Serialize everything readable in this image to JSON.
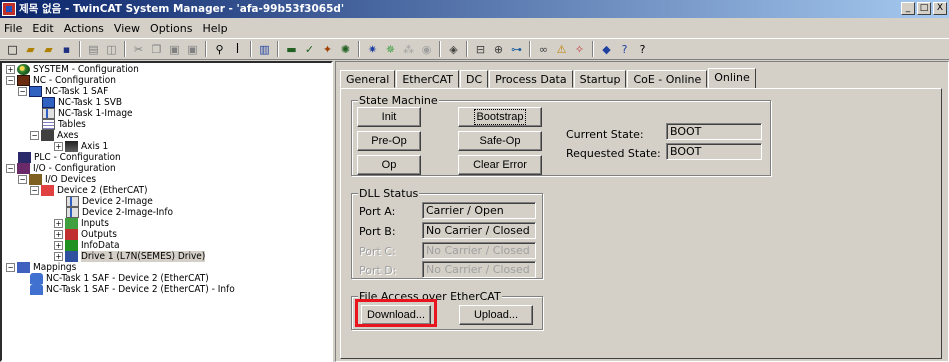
{
  "window": {
    "title": "제목 없음 - TwinCAT System Manager - 'afa-99b53f3065d'",
    "buttons": [
      "_",
      "□",
      "X"
    ]
  },
  "menu": {
    "items": [
      {
        "label": "File"
      },
      {
        "label": "Edit"
      },
      {
        "label": "Actions"
      },
      {
        "label": "View"
      },
      {
        "label": "Options"
      },
      {
        "label": "Help"
      }
    ]
  },
  "toolbar": {
    "icons": [
      "new-icon",
      "open-icon",
      "open-folder-icon",
      "save-icon",
      "print-icon",
      "print-preview-icon",
      "cut-icon",
      "copy-icon",
      "paste-icon",
      "paste-link-icon",
      "find-icon",
      "find-next-icon",
      "monitor-icon",
      "activate-icon",
      "check-icon",
      "set-run-icon",
      "restart-icon",
      "target-icon",
      "scan-icon",
      "toggle-icon",
      "free-run-icon",
      "show-online-icon",
      "zoom-icon",
      "link-icon",
      "var-icon",
      "var-new-icon",
      "help-icon",
      "about-icon"
    ]
  },
  "tree": {
    "nodes": [
      {
        "label": "SYSTEM - Configuration",
        "icon": "system-icon"
      },
      {
        "label": "NC - Configuration",
        "icon": "nc-icon"
      },
      {
        "label": "NC-Task 1 SAF",
        "icon": "task-icon"
      },
      {
        "label": "NC-Task 1 SVB",
        "icon": "task-icon"
      },
      {
        "label": "NC-Task 1-Image",
        "icon": "image-icon"
      },
      {
        "label": "Tables",
        "icon": "tables-icon"
      },
      {
        "label": "Axes",
        "icon": "axes-icon"
      },
      {
        "label": "Axis 1",
        "icon": "axis-icon"
      },
      {
        "label": "PLC - Configuration",
        "icon": "plc-icon"
      },
      {
        "label": "I/O - Configuration",
        "icon": "io-icon"
      },
      {
        "label": "I/O Devices",
        "icon": "devices-icon"
      },
      {
        "label": "Device 2 (EtherCAT)",
        "icon": "ethercat-device-icon"
      },
      {
        "label": "Device 2-Image",
        "icon": "image-icon"
      },
      {
        "label": "Device 2-Image-Info",
        "icon": "image-icon"
      },
      {
        "label": "Inputs",
        "icon": "inputs-icon"
      },
      {
        "label": "Outputs",
        "icon": "outputs-icon"
      },
      {
        "label": "InfoData",
        "icon": "infodata-icon"
      },
      {
        "label": "Drive 1 (L7N(SEMES) Drive)",
        "icon": "drive-icon"
      },
      {
        "label": "Mappings",
        "icon": "mappings-icon"
      },
      {
        "label": "NC-Task 1 SAF - Device 2 (EtherCAT)",
        "icon": "mapping-item-icon"
      },
      {
        "label": "NC-Task 1 SAF - Device 2 (EtherCAT) - Info",
        "icon": "mapping-item-icon"
      }
    ]
  },
  "tabs": [
    {
      "label": "General"
    },
    {
      "label": "EtherCAT"
    },
    {
      "label": "DC"
    },
    {
      "label": "Process Data"
    },
    {
      "label": "Startup"
    },
    {
      "label": "CoE - Online"
    },
    {
      "label": "Online"
    }
  ],
  "state_machine": {
    "title": "State Machine",
    "buttons": {
      "init": "Init",
      "bootstrap": "Bootstrap",
      "preop": "Pre-Op",
      "safeop": "Safe-Op",
      "op": "Op",
      "clear_error": "Clear Error"
    },
    "current_state_label": "Current State:",
    "current_state_value": "BOOT",
    "requested_state_label": "Requested State:",
    "requested_state_value": "BOOT"
  },
  "dll_status": {
    "title": "DLL Status",
    "ports": [
      {
        "label": "Port A:",
        "value": "Carrier / Open",
        "enabled": true
      },
      {
        "label": "Port B:",
        "value": "No Carrier / Closed",
        "enabled": true
      },
      {
        "label": "Port C:",
        "value": "No Carrier / Closed",
        "enabled": false
      },
      {
        "label": "Port D:",
        "value": "No Carrier / Closed",
        "enabled": false
      }
    ]
  },
  "file_access": {
    "title": "File Access over EtherCAT",
    "download": "Download...",
    "upload": "Upload..."
  },
  "colors": {
    "highlight": "#e8141e",
    "titlebar_start": "#0a246a",
    "titlebar_end": "#a6caf0"
  }
}
